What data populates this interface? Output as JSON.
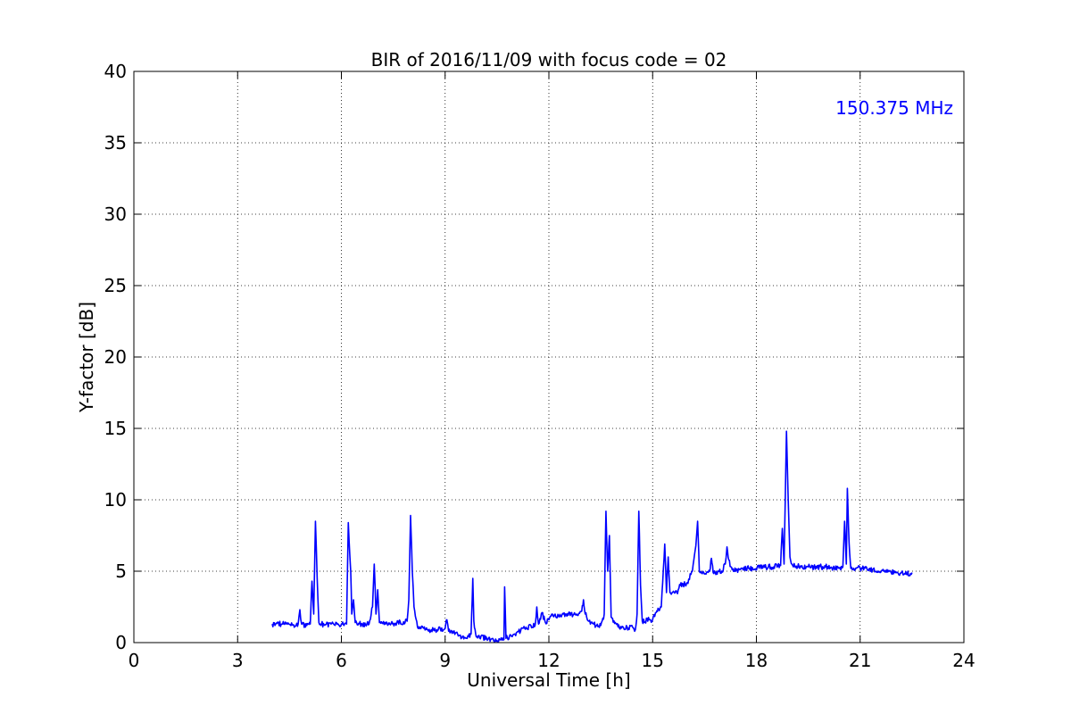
{
  "chart_data": {
    "type": "line",
    "title": "BIR of 2016/11/09 with focus code = 02",
    "xlabel": "Universal Time [h]",
    "ylabel": "Y-factor [dB]",
    "xlim": [
      0,
      24
    ],
    "ylim": [
      0,
      40
    ],
    "xticks": [
      0,
      3,
      6,
      9,
      12,
      15,
      18,
      21,
      24
    ],
    "yticks": [
      0,
      5,
      10,
      15,
      20,
      25,
      30,
      35,
      40
    ],
    "grid": true,
    "annotation": "150.375 MHz",
    "series": [
      {
        "color": "#0000ff",
        "points": [
          [
            4.0,
            1.3
          ],
          [
            4.3,
            1.3
          ],
          [
            4.6,
            1.25
          ],
          [
            4.75,
            1.3
          ],
          [
            4.8,
            2.3
          ],
          [
            4.85,
            1.3
          ],
          [
            5.0,
            1.2
          ],
          [
            5.1,
            1.3
          ],
          [
            5.15,
            4.3
          ],
          [
            5.2,
            2.0
          ],
          [
            5.25,
            8.5
          ],
          [
            5.3,
            4.5
          ],
          [
            5.35,
            1.4
          ],
          [
            5.5,
            1.25
          ],
          [
            6.0,
            1.3
          ],
          [
            6.15,
            1.3
          ],
          [
            6.2,
            8.4
          ],
          [
            6.27,
            5.0
          ],
          [
            6.3,
            2.0
          ],
          [
            6.35,
            3.0
          ],
          [
            6.4,
            1.4
          ],
          [
            6.5,
            1.35
          ],
          [
            6.6,
            1.3
          ],
          [
            6.8,
            1.3
          ],
          [
            6.9,
            2.5
          ],
          [
            6.95,
            5.5
          ],
          [
            7.0,
            2.0
          ],
          [
            7.05,
            3.7
          ],
          [
            7.1,
            1.4
          ],
          [
            7.5,
            1.35
          ],
          [
            7.9,
            1.5
          ],
          [
            7.95,
            3.0
          ],
          [
            8.0,
            8.9
          ],
          [
            8.05,
            5.0
          ],
          [
            8.1,
            2.5
          ],
          [
            8.2,
            1.1
          ],
          [
            8.5,
            0.9
          ],
          [
            8.8,
            0.9
          ],
          [
            9.0,
            1.0
          ],
          [
            9.05,
            1.6
          ],
          [
            9.1,
            0.8
          ],
          [
            9.4,
            0.5
          ],
          [
            9.6,
            0.3
          ],
          [
            9.75,
            0.6
          ],
          [
            9.8,
            4.5
          ],
          [
            9.83,
            1.5
          ],
          [
            9.9,
            0.4
          ],
          [
            10.2,
            0.3
          ],
          [
            10.5,
            0.15
          ],
          [
            10.7,
            0.2
          ],
          [
            10.72,
            3.9
          ],
          [
            10.76,
            0.3
          ],
          [
            11.0,
            0.6
          ],
          [
            11.3,
            1.0
          ],
          [
            11.6,
            1.2
          ],
          [
            11.65,
            2.5
          ],
          [
            11.7,
            1.3
          ],
          [
            11.8,
            2.1
          ],
          [
            11.9,
            1.4
          ],
          [
            12.0,
            1.6
          ],
          [
            12.1,
            2.0
          ],
          [
            12.3,
            1.8
          ],
          [
            12.5,
            2.0
          ],
          [
            12.8,
            2.0
          ],
          [
            12.95,
            2.2
          ],
          [
            13.0,
            3.0
          ],
          [
            13.05,
            2.0
          ],
          [
            13.2,
            1.3
          ],
          [
            13.5,
            1.2
          ],
          [
            13.6,
            2.0
          ],
          [
            13.65,
            9.2
          ],
          [
            13.7,
            5.0
          ],
          [
            13.75,
            7.5
          ],
          [
            13.8,
            1.8
          ],
          [
            14.0,
            1.1
          ],
          [
            14.3,
            1.0
          ],
          [
            14.4,
            1.2
          ],
          [
            14.5,
            0.9
          ],
          [
            14.55,
            2.0
          ],
          [
            14.6,
            9.2
          ],
          [
            14.65,
            4.0
          ],
          [
            14.7,
            1.5
          ],
          [
            14.9,
            1.6
          ],
          [
            15.0,
            1.6
          ],
          [
            15.1,
            2.1
          ],
          [
            15.25,
            2.5
          ],
          [
            15.35,
            6.9
          ],
          [
            15.4,
            3.5
          ],
          [
            15.45,
            6.0
          ],
          [
            15.5,
            3.5
          ],
          [
            15.7,
            3.5
          ],
          [
            15.8,
            4.0
          ],
          [
            16.0,
            4.2
          ],
          [
            16.15,
            5.0
          ],
          [
            16.25,
            6.8
          ],
          [
            16.3,
            8.5
          ],
          [
            16.35,
            5.0
          ],
          [
            16.5,
            4.8
          ],
          [
            16.65,
            5.0
          ],
          [
            16.7,
            5.9
          ],
          [
            16.75,
            4.9
          ],
          [
            17.0,
            5.0
          ],
          [
            17.1,
            5.5
          ],
          [
            17.15,
            6.7
          ],
          [
            17.2,
            5.8
          ],
          [
            17.3,
            5.1
          ],
          [
            17.5,
            5.1
          ],
          [
            17.8,
            5.2
          ],
          [
            18.2,
            5.3
          ],
          [
            18.5,
            5.3
          ],
          [
            18.7,
            5.4
          ],
          [
            18.75,
            8.0
          ],
          [
            18.8,
            5.5
          ],
          [
            18.87,
            14.8
          ],
          [
            18.92,
            10.0
          ],
          [
            18.97,
            6.0
          ],
          [
            19.05,
            5.4
          ],
          [
            19.5,
            5.3
          ],
          [
            20.0,
            5.3
          ],
          [
            20.4,
            5.2
          ],
          [
            20.5,
            5.3
          ],
          [
            20.55,
            8.5
          ],
          [
            20.6,
            5.5
          ],
          [
            20.63,
            10.8
          ],
          [
            20.68,
            7.0
          ],
          [
            20.73,
            5.2
          ],
          [
            21.0,
            5.2
          ],
          [
            21.5,
            5.0
          ],
          [
            22.0,
            4.9
          ],
          [
            22.3,
            4.8
          ],
          [
            22.5,
            4.9
          ]
        ]
      }
    ]
  }
}
